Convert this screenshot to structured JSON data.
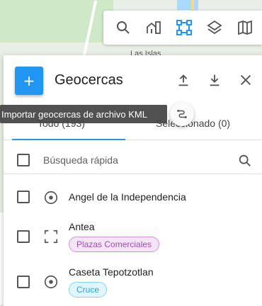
{
  "map": {
    "place_label": "Las Islas"
  },
  "toolbar": {
    "icons": [
      "search-icon",
      "buildings-icon",
      "select-area-icon",
      "layers-icon",
      "map-icon"
    ]
  },
  "panel": {
    "title": "Geocercas",
    "add_symbol": "+",
    "tabs": {
      "all": "Todo (193)",
      "selected": "Seleccionado (0)"
    },
    "search_placeholder": "Búsqueda rápida",
    "tooltip": "Importar geocercas de archivo KML",
    "items": [
      {
        "name": "Angel de la Independencia",
        "type": "circle",
        "badge": ""
      },
      {
        "name": "Antea",
        "type": "polygon",
        "badge": "Plazas Comerciales",
        "badge_color": "#ab47bc",
        "badge_bg": "#f3e5f5"
      },
      {
        "name": "Caseta Tepotzotlan",
        "type": "circle",
        "badge": "Cruce",
        "badge_color": "#29a3d6",
        "badge_bg": "#e1f5fe"
      }
    ]
  }
}
